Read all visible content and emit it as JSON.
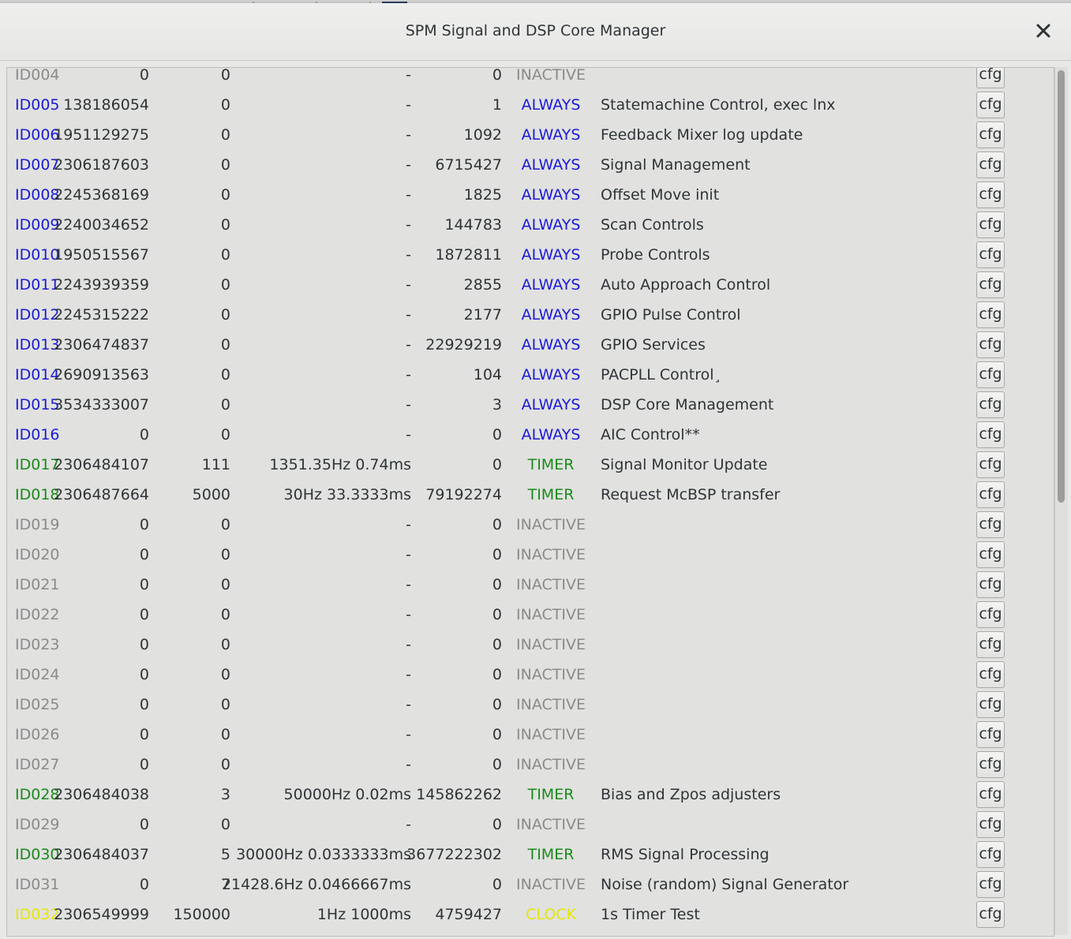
{
  "window": {
    "title": "SPM Signal and DSP Core Manager"
  },
  "colors": {
    "inactive": "#8a8a8a",
    "always": "#1a1ad6",
    "timer": "#1a8a1a",
    "clock": "#e6e60a",
    "text": "#2e3436"
  },
  "rows": [
    {
      "id": "ID004",
      "a": "0",
      "b": "0",
      "c": "-",
      "d": "0",
      "mode": "INACTIVE",
      "desc": "",
      "state": "inactive"
    },
    {
      "id": "ID005",
      "a": "138186054",
      "b": "0",
      "c": "-",
      "d": "1",
      "mode": "ALWAYS",
      "desc": "Statemachine Control, exec lnx",
      "state": "always"
    },
    {
      "id": "ID006",
      "a": "1951129275",
      "b": "0",
      "c": "-",
      "d": "1092",
      "mode": "ALWAYS",
      "desc": "Feedback Mixer log update",
      "state": "always"
    },
    {
      "id": "ID007",
      "a": "2306187603",
      "b": "0",
      "c": "-",
      "d": "6715427",
      "mode": "ALWAYS",
      "desc": "Signal Management",
      "state": "always"
    },
    {
      "id": "ID008",
      "a": "2245368169",
      "b": "0",
      "c": "-",
      "d": "1825",
      "mode": "ALWAYS",
      "desc": "Offset Move init",
      "state": "always"
    },
    {
      "id": "ID009",
      "a": "2240034652",
      "b": "0",
      "c": "-",
      "d": "144783",
      "mode": "ALWAYS",
      "desc": "Scan Controls",
      "state": "always"
    },
    {
      "id": "ID010",
      "a": "1950515567",
      "b": "0",
      "c": "-",
      "d": "1872811",
      "mode": "ALWAYS",
      "desc": "Probe Controls",
      "state": "always"
    },
    {
      "id": "ID011",
      "a": "2243939359",
      "b": "0",
      "c": "-",
      "d": "2855",
      "mode": "ALWAYS",
      "desc": "Auto Approach Control",
      "state": "always"
    },
    {
      "id": "ID012",
      "a": "2245315222",
      "b": "0",
      "c": "-",
      "d": "2177",
      "mode": "ALWAYS",
      "desc": "GPIO Pulse Control",
      "state": "always"
    },
    {
      "id": "ID013",
      "a": "2306474837",
      "b": "0",
      "c": "-",
      "d": "22929219",
      "mode": "ALWAYS",
      "desc": "GPIO Services",
      "state": "always"
    },
    {
      "id": "ID014",
      "a": "2690913563",
      "b": "0",
      "c": "-",
      "d": "104",
      "mode": "ALWAYS",
      "desc": "PACPLL Control¸",
      "state": "always"
    },
    {
      "id": "ID015",
      "a": "3534333007",
      "b": "0",
      "c": "-",
      "d": "3",
      "mode": "ALWAYS",
      "desc": "DSP Core Management",
      "state": "always"
    },
    {
      "id": "ID016",
      "a": "0",
      "b": "0",
      "c": "-",
      "d": "0",
      "mode": "ALWAYS",
      "desc": "AIC Control**",
      "state": "always"
    },
    {
      "id": "ID017",
      "a": "2306484107",
      "b": "111",
      "c": "1351.35Hz 0.74ms",
      "d": "0",
      "mode": "TIMER",
      "desc": "Signal Monitor Update",
      "state": "timer"
    },
    {
      "id": "ID018",
      "a": "2306487664",
      "b": "5000",
      "c": "30Hz 33.3333ms",
      "d": "79192274",
      "mode": "TIMER",
      "desc": "Request McBSP transfer",
      "state": "timer"
    },
    {
      "id": "ID019",
      "a": "0",
      "b": "0",
      "c": "-",
      "d": "0",
      "mode": "INACTIVE",
      "desc": "",
      "state": "inactive"
    },
    {
      "id": "ID020",
      "a": "0",
      "b": "0",
      "c": "-",
      "d": "0",
      "mode": "INACTIVE",
      "desc": "",
      "state": "inactive"
    },
    {
      "id": "ID021",
      "a": "0",
      "b": "0",
      "c": "-",
      "d": "0",
      "mode": "INACTIVE",
      "desc": "",
      "state": "inactive"
    },
    {
      "id": "ID022",
      "a": "0",
      "b": "0",
      "c": "-",
      "d": "0",
      "mode": "INACTIVE",
      "desc": "",
      "state": "inactive"
    },
    {
      "id": "ID023",
      "a": "0",
      "b": "0",
      "c": "-",
      "d": "0",
      "mode": "INACTIVE",
      "desc": "",
      "state": "inactive"
    },
    {
      "id": "ID024",
      "a": "0",
      "b": "0",
      "c": "-",
      "d": "0",
      "mode": "INACTIVE",
      "desc": "",
      "state": "inactive"
    },
    {
      "id": "ID025",
      "a": "0",
      "b": "0",
      "c": "-",
      "d": "0",
      "mode": "INACTIVE",
      "desc": "",
      "state": "inactive"
    },
    {
      "id": "ID026",
      "a": "0",
      "b": "0",
      "c": "-",
      "d": "0",
      "mode": "INACTIVE",
      "desc": "",
      "state": "inactive"
    },
    {
      "id": "ID027",
      "a": "0",
      "b": "0",
      "c": "-",
      "d": "0",
      "mode": "INACTIVE",
      "desc": "",
      "state": "inactive"
    },
    {
      "id": "ID028",
      "a": "2306484038",
      "b": "3",
      "c": "50000Hz 0.02ms",
      "d": "145862262",
      "mode": "TIMER",
      "desc": "Bias and Zpos adjusters",
      "state": "timer"
    },
    {
      "id": "ID029",
      "a": "0",
      "b": "0",
      "c": "-",
      "d": "0",
      "mode": "INACTIVE",
      "desc": "",
      "state": "inactive"
    },
    {
      "id": "ID030",
      "a": "2306484037",
      "b": "5",
      "c": "30000Hz 0.0333333ms",
      "d": "3677222302",
      "mode": "TIMER",
      "desc": "RMS Signal Processing",
      "state": "timer"
    },
    {
      "id": "ID031",
      "a": "0",
      "b": "7",
      "c": "21428.6Hz 0.0466667ms",
      "d": "0",
      "mode": "INACTIVE",
      "desc": "Noise (random) Signal Generator",
      "state": "inactive"
    },
    {
      "id": "ID032",
      "a": "2306549999",
      "b": "150000",
      "c": "1Hz 1000ms",
      "d": "4759427",
      "mode": "CLOCK",
      "desc": "1s Timer Test",
      "state": "clock"
    }
  ],
  "cfg_label": "cfg"
}
